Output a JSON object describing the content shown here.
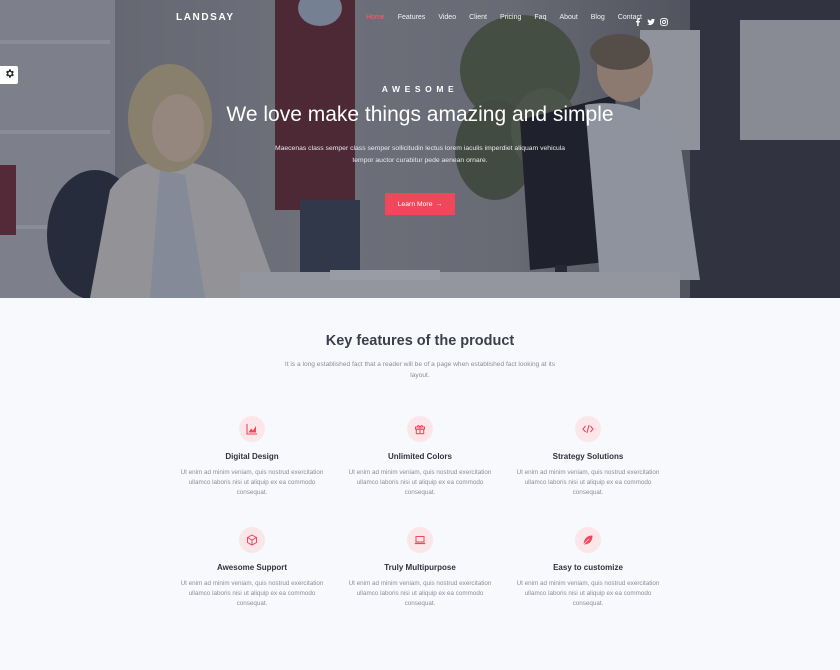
{
  "nav": {
    "brand": "LANDSAY",
    "items": [
      {
        "label": "Home",
        "active": true
      },
      {
        "label": "Features",
        "active": false
      },
      {
        "label": "Video",
        "active": false
      },
      {
        "label": "Client",
        "active": false
      },
      {
        "label": "Pricing",
        "active": false
      },
      {
        "label": "Faq",
        "active": false
      },
      {
        "label": "About",
        "active": false
      },
      {
        "label": "Blog",
        "active": false
      },
      {
        "label": "Contact",
        "active": false
      }
    ],
    "social": [
      "facebook-icon",
      "twitter-icon",
      "instagram-icon"
    ]
  },
  "hero": {
    "subtitle": "AWESOME",
    "title": "We love make things amazing and simple",
    "text": "Maecenas class semper class semper sollicitudin lectus lorem iaculis imperdiet aliquam vehicula tempor auctor curabitur pede aenean ornare.",
    "button_label": "Learn More",
    "button_arrow": "→"
  },
  "features": {
    "title": "Key features of the product",
    "description": "It is a long established fact that a reader will be of a page when established fact looking at its layout.",
    "items": [
      {
        "icon": "chart-area-icon",
        "title": "Digital Design",
        "text": "Ut enim ad minim veniam, quis nostrud exercitation ullamco laboris nisi ut aliquip ex ea commodo consequat."
      },
      {
        "icon": "gift-icon",
        "title": "Unlimited Colors",
        "text": "Ut enim ad minim veniam, quis nostrud exercitation ullamco laboris nisi ut aliquip ex ea commodo consequat."
      },
      {
        "icon": "code-icon",
        "title": "Strategy Solutions",
        "text": "Ut enim ad minim veniam, quis nostrud exercitation ullamco laboris nisi ut aliquip ex ea commodo consequat."
      },
      {
        "icon": "cube-icon",
        "title": "Awesome Support",
        "text": "Ut enim ad minim veniam, quis nostrud exercitation ullamco laboris nisi ut aliquip ex ea commodo consequat."
      },
      {
        "icon": "laptop-icon",
        "title": "Truly Multipurpose",
        "text": "Ut enim ad minim veniam, quis nostrud exercitation ullamco laboris nisi ut aliquip ex ea commodo consequat."
      },
      {
        "icon": "leaf-icon",
        "title": "Easy to customize",
        "text": "Ut enim ad minim veniam, quis nostrud exercitation ullamco laboris nisi ut aliquip ex ea commodo consequat."
      }
    ]
  },
  "colors": {
    "accent": "#f0475b",
    "icon_bg": "#fbe6ea"
  }
}
